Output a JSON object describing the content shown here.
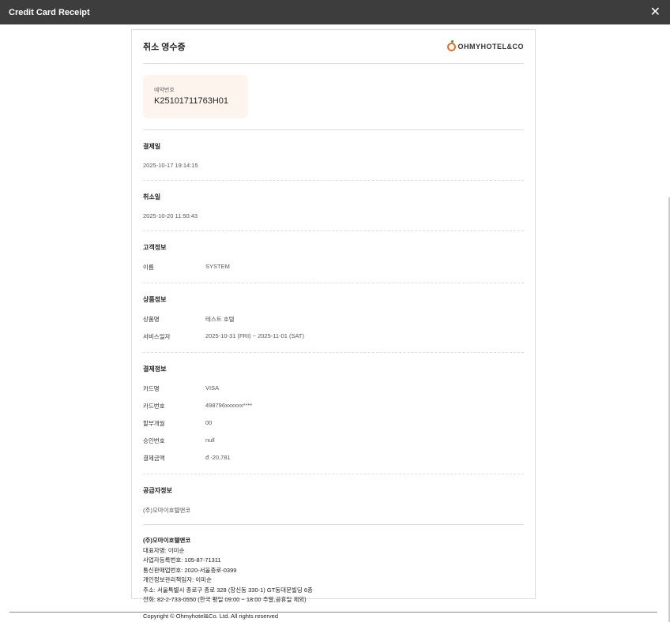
{
  "window": {
    "title": "Credit Card Receipt",
    "close_icon": "close-icon"
  },
  "receipt": {
    "title": "취소 영수증",
    "logo_text": "OHMYHOTEL&CO",
    "booking": {
      "label": "예약번호",
      "value": "K25101711763H01"
    },
    "payment_date": {
      "label": "결제일",
      "value": "2025-10-17 19:14:15"
    },
    "cancel_date": {
      "label": "취소일",
      "value": "2025-10-20 11:50:43"
    },
    "customer": {
      "label": "고객정보",
      "rows": [
        {
          "k": "이름",
          "v": "SYSTEM"
        }
      ]
    },
    "product": {
      "label": "상품정보",
      "rows": [
        {
          "k": "상품명",
          "v": "테스트 호텔"
        },
        {
          "k": "서비스일자",
          "v": "2025-10-31 (FRI) ~ 2025-11-01 (SAT)"
        }
      ]
    },
    "payment": {
      "label": "결제정보",
      "rows": [
        {
          "k": "카드명",
          "v": "VISA"
        },
        {
          "k": "카드번호",
          "v": "498796xxxxxx****"
        },
        {
          "k": "할부개월",
          "v": "00"
        },
        {
          "k": "승인번호",
          "v": "null"
        },
        {
          "k": "결제금액",
          "v": "đ -20,781"
        }
      ]
    },
    "supplier": {
      "label": "공급자정보",
      "value": "(주)오마이호텔앤코"
    },
    "footer": {
      "company": "(주)오마이호텔앤코",
      "lines": [
        "대표자명: 이미순",
        "사업자등록번호: 105-87-71311",
        "통신판매업번호: 2020-서울종로-0399",
        "개인정보관리책임자: 이미순",
        "주소: 서울특별시 종로구 종로 328 (창신동 330-1) GT동대문빌딩 6층",
        "전화: 82-2-733-0550 (한국 평일 09:00 ~ 18:00 주말,공휴일 제외)"
      ],
      "copyright": "Copyright © Ohmyhotel&Co. Ltd. All rights reserved"
    }
  }
}
